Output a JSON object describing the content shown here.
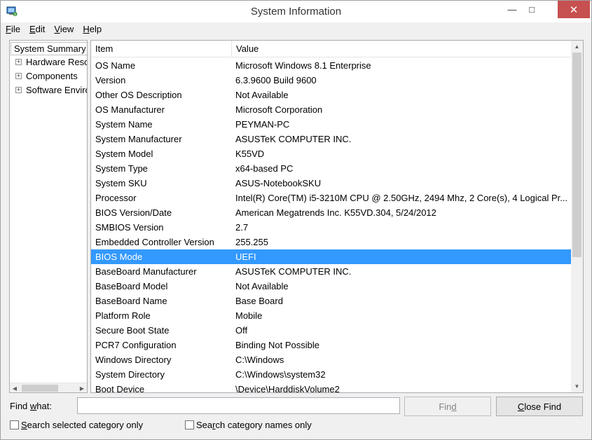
{
  "window": {
    "title": "System Information",
    "icon": "system-information-icon",
    "controls": {
      "minimize": "—",
      "maximize": "□",
      "close": "✕"
    }
  },
  "menu": [
    {
      "key": "F",
      "rest": "ile"
    },
    {
      "key": "E",
      "rest": "dit"
    },
    {
      "key": "V",
      "rest": "iew"
    },
    {
      "key": "H",
      "rest": "elp"
    }
  ],
  "tree": {
    "root": "System Summary",
    "nodes": [
      "Hardware Resources",
      "Components",
      "Software Environment"
    ]
  },
  "table": {
    "columns": [
      "Item",
      "Value"
    ],
    "selected_index": 13,
    "rows": [
      [
        "OS Name",
        "Microsoft Windows 8.1 Enterprise"
      ],
      [
        "Version",
        "6.3.9600 Build 9600"
      ],
      [
        "Other OS Description",
        "Not Available"
      ],
      [
        "OS Manufacturer",
        "Microsoft Corporation"
      ],
      [
        "System Name",
        "PEYMAN-PC"
      ],
      [
        "System Manufacturer",
        "ASUSTeK COMPUTER INC."
      ],
      [
        "System Model",
        "K55VD"
      ],
      [
        "System Type",
        "x64-based PC"
      ],
      [
        "System SKU",
        "ASUS-NotebookSKU"
      ],
      [
        "Processor",
        "Intel(R) Core(TM) i5-3210M CPU @ 2.50GHz, 2494 Mhz, 2 Core(s), 4 Logical Pr..."
      ],
      [
        "BIOS Version/Date",
        "American Megatrends Inc. K55VD.304, 5/24/2012"
      ],
      [
        "SMBIOS Version",
        "2.7"
      ],
      [
        "Embedded Controller Version",
        "255.255"
      ],
      [
        "BIOS Mode",
        "UEFI"
      ],
      [
        "BaseBoard Manufacturer",
        "ASUSTeK COMPUTER INC."
      ],
      [
        "BaseBoard Model",
        "Not Available"
      ],
      [
        "BaseBoard Name",
        "Base Board"
      ],
      [
        "Platform Role",
        "Mobile"
      ],
      [
        "Secure Boot State",
        "Off"
      ],
      [
        "PCR7 Configuration",
        "Binding Not Possible"
      ],
      [
        "Windows Directory",
        "C:\\Windows"
      ],
      [
        "System Directory",
        "C:\\Windows\\system32"
      ],
      [
        "Boot Device",
        "\\Device\\HarddiskVolume2"
      ]
    ]
  },
  "find": {
    "label_key": "w",
    "label_pre": "Find ",
    "label_post": "hat:",
    "input_value": "",
    "find_button": {
      "pre": "Fin",
      "key": "d",
      "post": ""
    },
    "close_button": {
      "pre": "",
      "key": "C",
      "post": "lose Find"
    },
    "search_selected": {
      "pre": "",
      "key": "S",
      "post": "earch selected category only",
      "checked": false
    },
    "search_names": {
      "pre": "Sea",
      "key": "r",
      "post": "ch category names only",
      "checked": false
    }
  },
  "colors": {
    "selection": "#3399ff",
    "close_button": "#c75050"
  }
}
